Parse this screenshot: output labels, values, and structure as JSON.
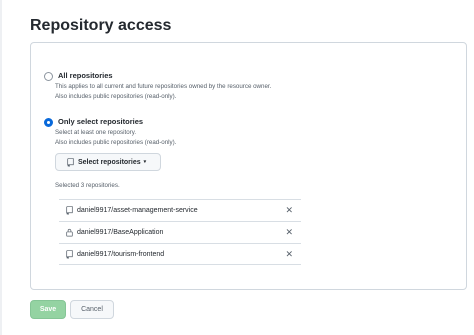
{
  "page": {
    "title": "Repository access"
  },
  "options": {
    "all": {
      "label": "All repositories",
      "note_line1": "This applies to all current and future repositories owned by the resource owner.",
      "note_line2": "Also includes public repositories (read-only).",
      "checked": false
    },
    "only": {
      "label": "Only select repositories",
      "note_line1": "Select at least one repository.",
      "note_line2": "Also includes public repositories (read-only).",
      "checked": true
    }
  },
  "select_button": {
    "label": "Select repositories",
    "caret": "▾"
  },
  "selected_count": "Selected 3 repositories.",
  "repositories": [
    {
      "owner": "daniel9917/",
      "name": "asset-management-service",
      "icon": "repo-icon"
    },
    {
      "owner": "daniel9917/",
      "name": "BaseApplication",
      "icon": "lock-icon"
    },
    {
      "owner": "daniel9917/",
      "name": "tourism-frontend",
      "icon": "repo-icon"
    }
  ],
  "remove_symbol": "✕",
  "actions": {
    "save": "Save",
    "cancel": "Cancel"
  },
  "colors": {
    "accent": "#0969da",
    "save_disabled": "#94d3a2"
  }
}
